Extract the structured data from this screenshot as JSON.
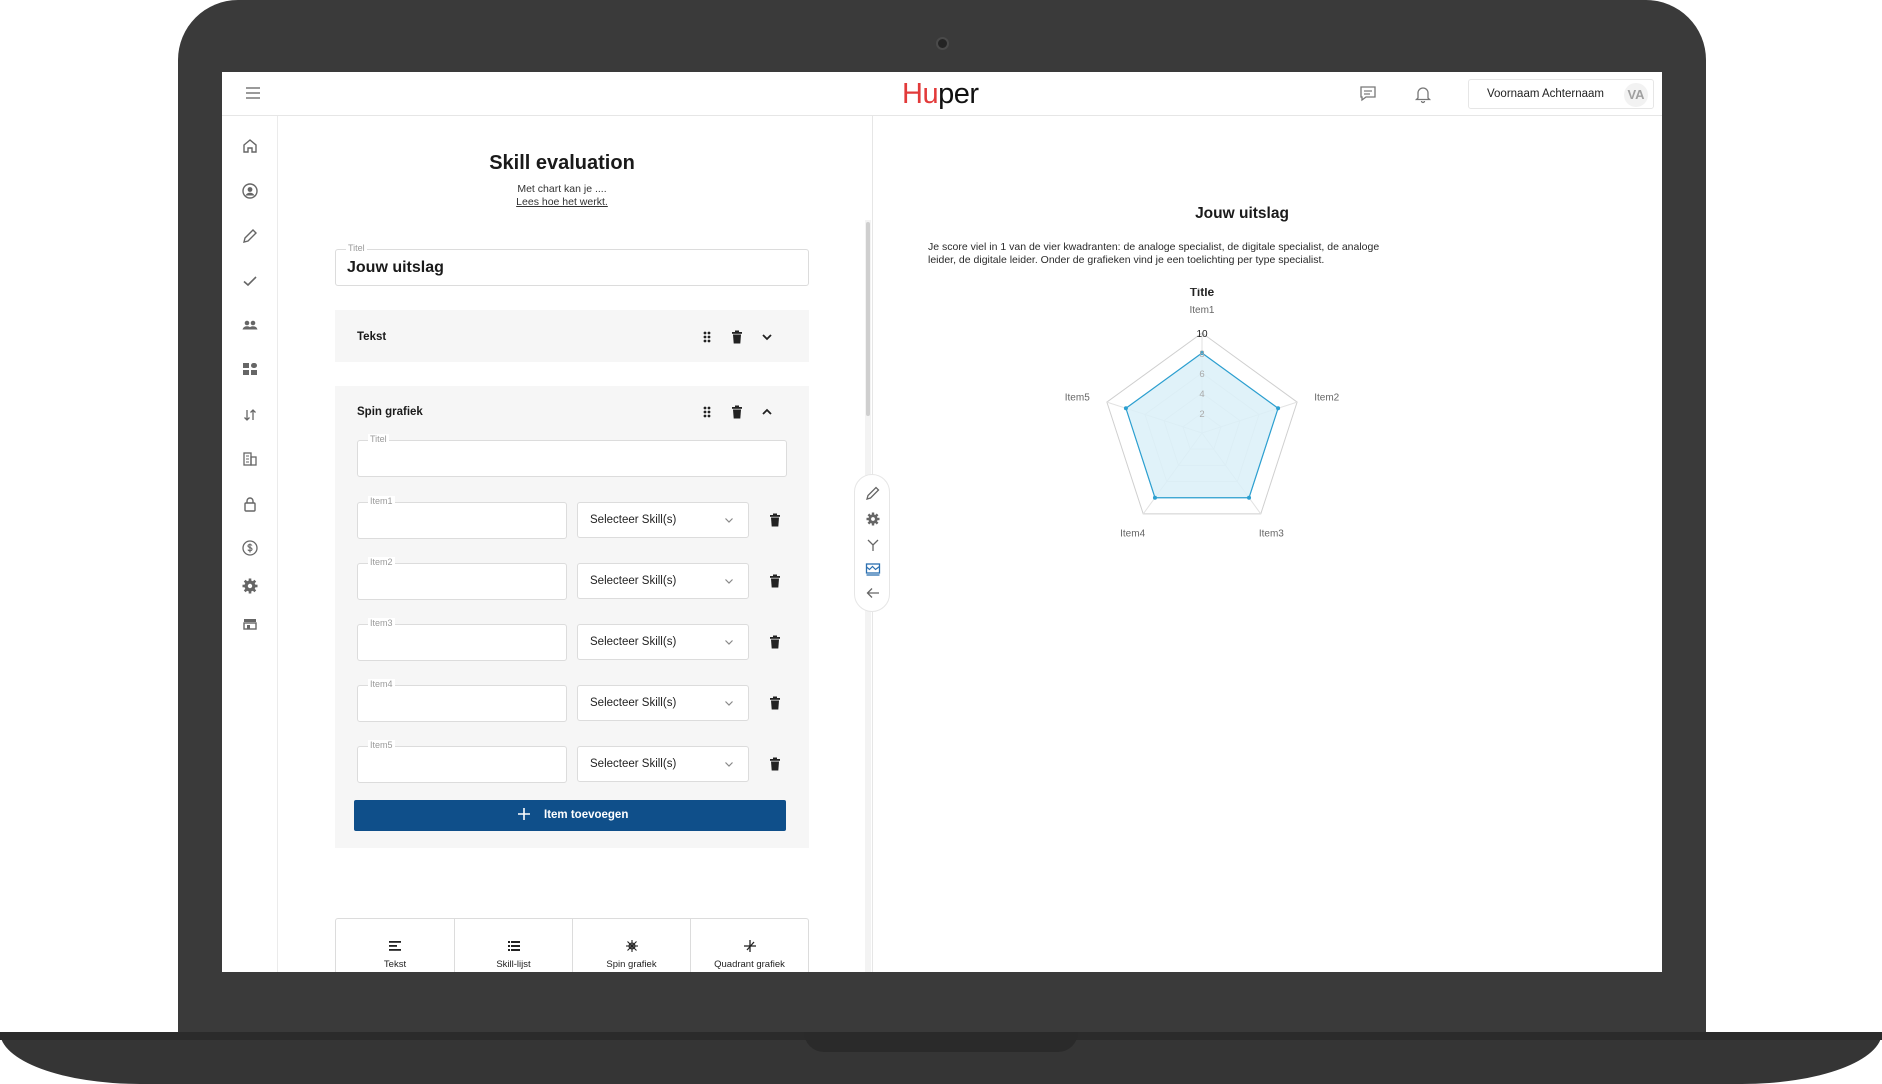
{
  "app": {
    "logo_part1": "Hu",
    "logo_part2": "per"
  },
  "header": {
    "user_name": "Voornaam Achternaam",
    "user_initials": "VA",
    "icons": [
      "menu-icon",
      "chat-icon",
      "bell-icon"
    ]
  },
  "sidebar": {
    "icons": [
      "home-icon",
      "user-circle-icon",
      "pencil-icon",
      "check-icon",
      "team-icon",
      "dashboard-icon",
      "transfer-icon",
      "building-icon",
      "lock-icon",
      "dollar-icon",
      "gear-icon",
      "store-icon"
    ]
  },
  "editor": {
    "title": "Skill evaluation",
    "subtitle": "Met chart kan je ....",
    "link": "Lees hoe het werkt.",
    "title_field": {
      "label": "Titel",
      "value": "Jouw uitslag"
    },
    "blocks": [
      {
        "title": "Tekst",
        "expanded": false
      },
      {
        "title": "Spin grafiek",
        "expanded": true
      }
    ],
    "spin": {
      "title_label": "Titel",
      "title_value": "",
      "items": [
        {
          "label": "Item1",
          "value": "",
          "select": "Selecteer Skill(s)"
        },
        {
          "label": "Item2",
          "value": "",
          "select": "Selecteer Skill(s)"
        },
        {
          "label": "Item3",
          "value": "",
          "select": "Selecteer Skill(s)"
        },
        {
          "label": "Item4",
          "value": "",
          "select": "Selecteer Skill(s)"
        },
        {
          "label": "Item5",
          "value": "",
          "select": "Selecteer Skill(s)"
        }
      ],
      "add_label": "Item toevoegen"
    },
    "palette": [
      {
        "label": "Tekst",
        "icon": "text-align-icon"
      },
      {
        "label": "Skill-lijst",
        "icon": "list-icon"
      },
      {
        "label": "Spin grafiek",
        "icon": "spider-icon"
      },
      {
        "label": "Quadrant grafiek",
        "icon": "quadrant-icon"
      }
    ]
  },
  "floating_toolbar": [
    "pencil-icon",
    "gear-icon",
    "branch-icon",
    "chart-flag-icon",
    "arrow-left-icon"
  ],
  "preview": {
    "title": "Jouw uitslag",
    "description": "Je score viel in 1 van de vier kwadranten: de analoge specialist, de digitale specialist, de analoge leider, de digitale leider. Onder de grafieken vind je een toelichting per type specialist."
  },
  "colors": {
    "accent": "#0f4f8a",
    "brand_red": "#e23a3a",
    "radar_fill": "#daf0f8",
    "radar_stroke": "#2b9fd0"
  },
  "chart_data": {
    "type": "radar",
    "title": "Title",
    "categories": [
      "Item1",
      "Item2",
      "Item3",
      "Item4",
      "Item5"
    ],
    "series": [
      {
        "values": [
          8,
          8,
          8,
          8,
          8
        ]
      }
    ],
    "rlim": [
      0,
      10
    ],
    "ticks": [
      "2",
      "4",
      "6",
      "8",
      "10"
    ],
    "grid": true
  }
}
